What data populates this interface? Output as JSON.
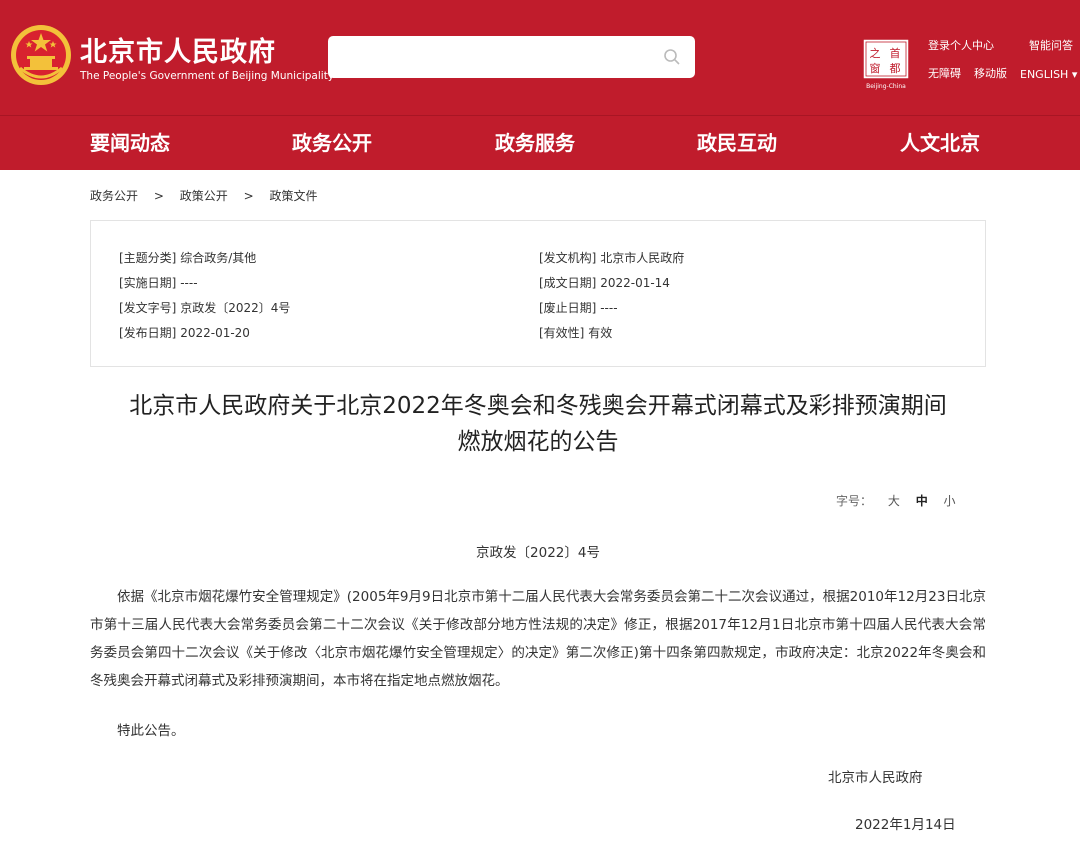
{
  "header": {
    "site_name": "北京市人民政府",
    "site_name_en": "The People's Government of Beijing Municipality",
    "search": {
      "placeholder": "",
      "value": ""
    },
    "capital_logo_text": [
      "之",
      "首",
      "窗",
      "都"
    ],
    "capital_logo_caption": "Beijing-China",
    "links": {
      "login": "登录个人中心",
      "smart_qa": "智能问答",
      "accessibility": "无障碍",
      "mobile": "移动版",
      "english": "ENGLISH ▾"
    },
    "colors": {
      "brand_red": "#c01c2c",
      "emblem_gold": "#f3c13a"
    }
  },
  "nav": {
    "items": [
      "要闻动态",
      "政务公开",
      "政务服务",
      "政民互动",
      "人文北京"
    ]
  },
  "breadcrumb": [
    "政务公开",
    "政策公开",
    "政策文件"
  ],
  "breadcrumb_sep": ">",
  "meta": {
    "topic_label": "[主题分类]",
    "topic_value": "综合政务/其他",
    "issuer_label": "[发文机构]",
    "issuer_value": "北京市人民政府",
    "impl_date_label": "[实施日期]",
    "impl_date_value": "----",
    "created_label": "[成文日期]",
    "created_value": "2022-01-14",
    "doc_no_label": "[发文字号]",
    "doc_no_value": "京政发〔2022〕4号",
    "expire_label": "[废止日期]",
    "expire_value": "----",
    "publish_label": "[发布日期]",
    "publish_value": "2022-01-20",
    "validity_label": "[有效性]",
    "validity_value": "有效"
  },
  "doc": {
    "title_line1": "北京市人民政府关于北京2022年冬奥会和冬残奥会开幕式闭幕式及彩排预演期间",
    "title_line2": "燃放烟花的公告",
    "font_size_label": "字号：",
    "font_sizes": [
      "大",
      "中",
      "小"
    ],
    "number": "京政发〔2022〕4号",
    "body": "依据《北京市烟花爆竹安全管理规定》(2005年9月9日北京市第十二届人民代表大会常务委员会第二十二次会议通过，根据2010年12月23日北京市第十三届人民代表大会常务委员会第二十二次会议《关于修改部分地方性法规的决定》修正，根据2017年12月1日北京市第十四届人民代表大会常务委员会第四十二次会议《关于修改〈北京市烟花爆竹安全管理规定〉的决定》第二次修正)第十四条第四款规定，市政府决定：北京2022年冬奥会和冬残奥会开幕式闭幕式及彩排预演期间，本市将在指定地点燃放烟花。",
    "closing": "特此公告。",
    "sign_org": "北京市人民政府",
    "sign_date": "2022年1月14日"
  }
}
